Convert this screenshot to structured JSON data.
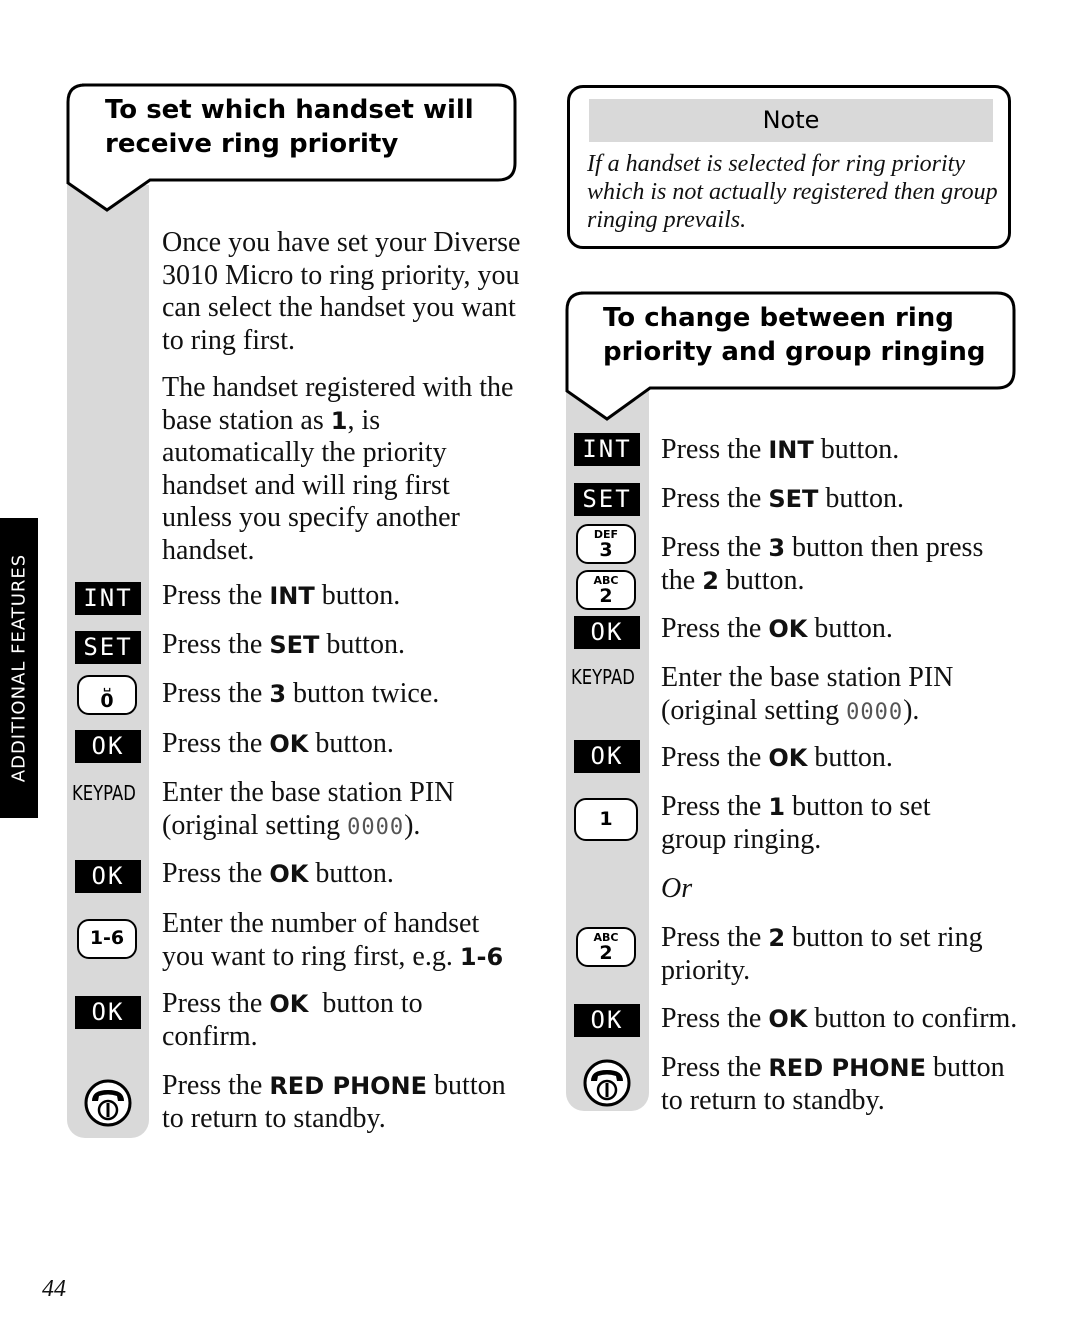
{
  "side_tab": {
    "label": "ADDITIONAL FEATURES"
  },
  "left_section": {
    "title_line1": "To set which handset will",
    "title_line2": "receive ring priority",
    "intro_p1": "Once you have set your Diverse 3010 Micro to ring priority, you can select the handset you want to ring first.",
    "intro_p2_before": "The handset registered with the base station as ",
    "intro_p2_bold": "1",
    "intro_p2_after": ", is automatically the priority handset and will ring first unless you specify another handset.",
    "steps": [
      {
        "icon": "INT",
        "icon_type": "black-key",
        "pre": "Press the ",
        "bold": "INT",
        "post": " button."
      },
      {
        "icon": "SET",
        "icon_type": "black-key",
        "pre": "Press the ",
        "bold": "SET",
        "post": " button."
      },
      {
        "icon": "0",
        "icon_sub": "␣",
        "icon_type": "round-key",
        "pre": "Press the ",
        "bold": "3",
        "post": " button twice."
      },
      {
        "icon": "OK",
        "icon_type": "black-key",
        "pre": "Press the ",
        "bold": "OK",
        "post": " button."
      },
      {
        "icon": "KEYPAD",
        "icon_type": "label",
        "line1": "Enter the base station PIN",
        "line2_pre": "(original setting ",
        "line2_code": "0000",
        "line2_post": ")."
      },
      {
        "icon": "OK",
        "icon_type": "black-key",
        "pre": "Press the ",
        "bold": "OK",
        "post": " button."
      },
      {
        "icon": "1-6",
        "icon_type": "round-key",
        "line1": "Enter the number of handset",
        "line2_pre": "you want to ring first, e.g. ",
        "line2_bold": "1-6"
      },
      {
        "icon": "OK",
        "icon_type": "black-key",
        "pre": "Press the ",
        "bold": "OK",
        "post": "  button to",
        "line2": "confirm."
      },
      {
        "icon": "red-phone-icon",
        "icon_type": "phone",
        "pre": "Press the ",
        "bold": "RED PHONE",
        "post": " button",
        "line2": "to return to standby."
      }
    ]
  },
  "note": {
    "heading": "Note",
    "body": "If a handset is selected for ring priority which is not actually registered then group ringing prevails."
  },
  "right_section": {
    "title_line1": "To change between ring",
    "title_line2": "priority and group ringing",
    "steps": [
      {
        "icon": "INT",
        "icon_type": "black-key",
        "pre": "Press the ",
        "bold": "INT",
        "post": " button."
      },
      {
        "icon": "SET",
        "icon_type": "black-key",
        "pre": "Press the ",
        "bold": "SET",
        "post": " button."
      },
      {
        "icon": "3",
        "icon_sub": "DEF",
        "icon_type": "round-key",
        "pre": "Press the ",
        "bold": "3",
        "post": " button then press"
      },
      {
        "icon": "2",
        "icon_sub": "ABC",
        "icon_type": "round-key",
        "pre": "the ",
        "bold": "2",
        "post": " button."
      },
      {
        "icon": "OK",
        "icon_type": "black-key",
        "pre": "Press the ",
        "bold": "OK",
        "post": " button."
      },
      {
        "icon": "KEYPAD",
        "icon_type": "label",
        "line1": "Enter the base station PIN",
        "line2_pre": "(original setting ",
        "line2_code": "0000",
        "line2_post": ")."
      },
      {
        "icon": "OK",
        "icon_type": "black-key",
        "pre": "Press the ",
        "bold": "OK",
        "post": " button."
      },
      {
        "icon": "1",
        "icon_type": "round-key",
        "pre": "Press the ",
        "bold": "1",
        "post": " button to set",
        "line2": "group ringing."
      },
      {
        "or_label": "Or"
      },
      {
        "icon": "2",
        "icon_sub": "ABC",
        "icon_type": "round-key",
        "pre": "Press the ",
        "bold": "2",
        "post": " button to set ring",
        "line2": "priority."
      },
      {
        "icon": "OK",
        "icon_type": "black-key",
        "pre": "Press the ",
        "bold": "OK",
        "post": " button to confirm."
      },
      {
        "icon": "red-phone-icon",
        "icon_type": "phone",
        "pre": "Press the ",
        "bold": "RED PHONE",
        "post": " button",
        "line2": "to return to standby."
      }
    ]
  },
  "page_number": "44"
}
